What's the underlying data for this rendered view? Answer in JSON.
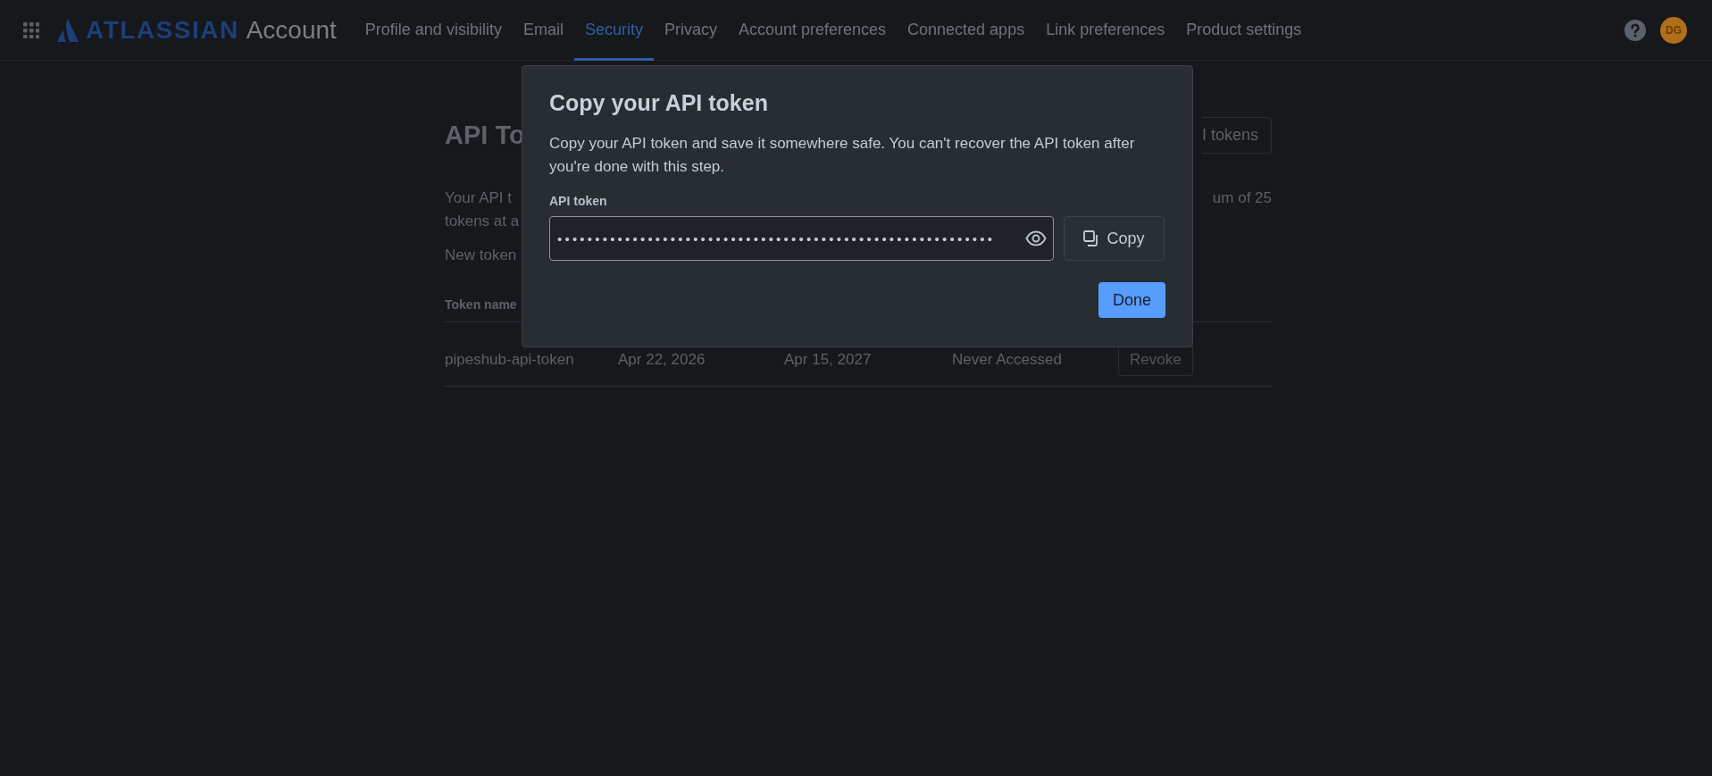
{
  "header": {
    "logo": {
      "brand": "ATLASSIAN",
      "product": "Account"
    },
    "nav": [
      {
        "label": "Profile and visibility",
        "selected": false
      },
      {
        "label": "Email",
        "selected": false
      },
      {
        "label": "Security",
        "selected": true
      },
      {
        "label": "Privacy",
        "selected": false
      },
      {
        "label": "Account preferences",
        "selected": false
      },
      {
        "label": "Connected apps",
        "selected": false
      },
      {
        "label": "Link preferences",
        "selected": false
      },
      {
        "label": "Product settings",
        "selected": false
      }
    ],
    "avatar": "DG"
  },
  "page": {
    "title": "API To",
    "title_button": "I tokens",
    "intro_left": [
      "Your API t",
      "tokens at a"
    ],
    "intro_right": "um of 25",
    "note": "New token",
    "table": {
      "columns": [
        "Token name"
      ],
      "rows": [
        {
          "cells": [
            "pipeshub-api-token",
            "Apr 22, 2026",
            "Apr 15, 2027",
            "Never Accessed"
          ],
          "action": "Revoke"
        }
      ]
    }
  },
  "dialog": {
    "title": "Copy your API token",
    "text": "Copy your API token and save it somewhere safe. You can't recover the API token after you're done with this step.",
    "field": {
      "label": "API token",
      "value": "••••••••••••••••••••••••••••••••••••••••••••••••••••••••••"
    },
    "copy_button": "Copy",
    "done_button": "Done"
  }
}
